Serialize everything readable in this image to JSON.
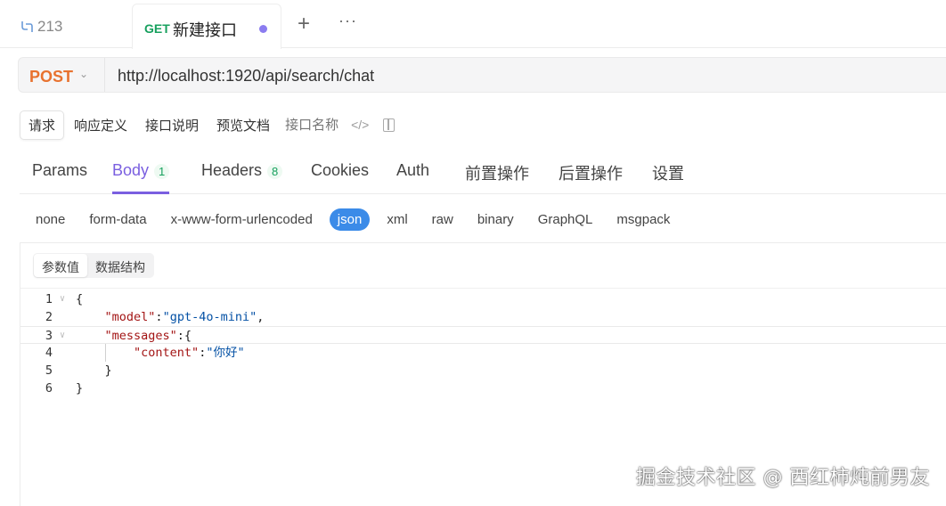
{
  "tabs": {
    "prev_label": "213",
    "active_method": "GET",
    "active_name": "新建接口",
    "add_label": "+",
    "more_label": "···"
  },
  "request": {
    "method": "POST",
    "url": "http://localhost:1920/api/search/chat"
  },
  "subtabs": [
    "请求",
    "响应定义",
    "接口说明",
    "预览文档"
  ],
  "name_placeholder": "接口名称",
  "maintabs": {
    "params": "Params",
    "body": "Body",
    "body_count": "1",
    "headers": "Headers",
    "headers_count": "8",
    "cookies": "Cookies",
    "auth": "Auth",
    "pre": "前置操作",
    "post": "后置操作",
    "settings": "设置"
  },
  "body_types": [
    "none",
    "form-data",
    "x-www-form-urlencoded",
    "json",
    "xml",
    "raw",
    "binary",
    "GraphQL",
    "msgpack"
  ],
  "body_type_selected": "json",
  "segment": {
    "params_value": "参数值",
    "data_structure": "数据结构"
  },
  "code_lines": [
    {
      "n": "1",
      "parts": [
        [
          "p",
          "{"
        ]
      ]
    },
    {
      "n": "2",
      "parts": [
        [
          "p",
          "    "
        ],
        [
          "k",
          "\"model\""
        ],
        [
          "p",
          ":"
        ],
        [
          "v",
          "\"gpt-4o-mini\""
        ],
        [
          "p",
          ","
        ]
      ]
    },
    {
      "n": "3",
      "parts": [
        [
          "p",
          "    "
        ],
        [
          "k",
          "\"messages\""
        ],
        [
          "p",
          ":{"
        ]
      ]
    },
    {
      "n": "4",
      "parts": [
        [
          "p",
          "        "
        ],
        [
          "k",
          "\"content\""
        ],
        [
          "p",
          ":"
        ],
        [
          "v",
          "\"你好\""
        ]
      ]
    },
    {
      "n": "5",
      "parts": [
        [
          "p",
          "    }"
        ]
      ]
    },
    {
      "n": "6",
      "parts": [
        [
          "p",
          "}"
        ]
      ]
    }
  ],
  "watermark": "掘金技术社区 @ 西红柿炖前男友",
  "colors": {
    "accent": "#7a5fe0",
    "post": "#e8722f",
    "get": "#17a05e",
    "json_pill": "#3b8be8"
  }
}
